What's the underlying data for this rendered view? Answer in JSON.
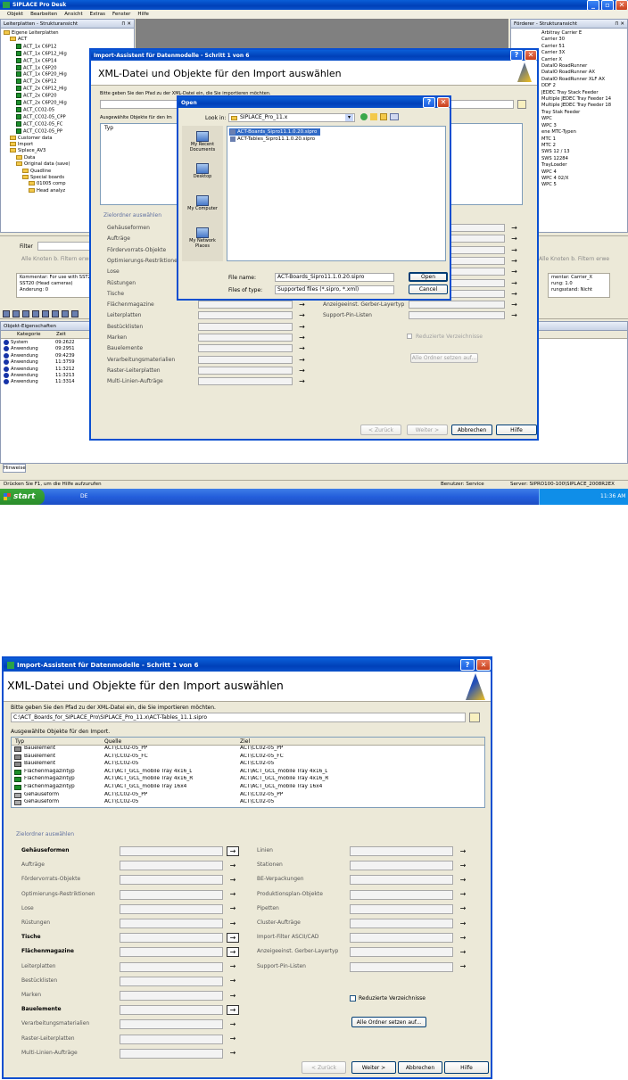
{
  "shot1": {
    "app_title": "SIPLACE Pro Desk",
    "menu": [
      "Objekt",
      "Bearbeiten",
      "Ansicht",
      "Extras",
      "Fenster",
      "Hilfe"
    ],
    "left_panel": {
      "title": "Leiterplatten - Strukturansicht",
      "tree": [
        {
          "label": "Eigene Leiterplatten",
          "depth": 0,
          "icon": "folder-icon"
        },
        {
          "label": "ACT",
          "depth": 1,
          "icon": "folder-icon"
        },
        {
          "label": "ACT_1x C6P12",
          "depth": 2,
          "icon": "board-icon"
        },
        {
          "label": "ACT_1x C6P12_Hig",
          "depth": 2,
          "icon": "board-icon"
        },
        {
          "label": "ACT_1x C6P14",
          "depth": 2,
          "icon": "board-icon"
        },
        {
          "label": "ACT_1x C6P20",
          "depth": 2,
          "icon": "board-icon"
        },
        {
          "label": "ACT_1x C6P20_Hig",
          "depth": 2,
          "icon": "board-icon"
        },
        {
          "label": "ACT_2x C6P12",
          "depth": 2,
          "icon": "board-icon"
        },
        {
          "label": "ACT_2x C6P12_Hig",
          "depth": 2,
          "icon": "board-icon"
        },
        {
          "label": "ACT_2x C6P20",
          "depth": 2,
          "icon": "board-icon"
        },
        {
          "label": "ACT_2x C6P20_Hig",
          "depth": 2,
          "icon": "board-icon"
        },
        {
          "label": "ACT_CC02-05",
          "depth": 2,
          "icon": "board-icon"
        },
        {
          "label": "ACT_CC02-05_CPP",
          "depth": 2,
          "icon": "board-icon"
        },
        {
          "label": "ACT_CC02-05_FC",
          "depth": 2,
          "icon": "board-icon"
        },
        {
          "label": "ACT_CC02-05_PP",
          "depth": 2,
          "icon": "board-icon"
        },
        {
          "label": "Customer data",
          "depth": 1,
          "icon": "folder-icon"
        },
        {
          "label": "Import",
          "depth": 1,
          "icon": "folder-icon"
        },
        {
          "label": "Siplace_AV3",
          "depth": 1,
          "icon": "folder-icon"
        },
        {
          "label": "Data",
          "depth": 2,
          "icon": "folder-icon"
        },
        {
          "label": "Original data (save)",
          "depth": 2,
          "icon": "folder-icon"
        },
        {
          "label": "Quadline",
          "depth": 3,
          "icon": "folder-icon"
        },
        {
          "label": "Special boards",
          "depth": 3,
          "icon": "folder-icon"
        },
        {
          "label": "01005 comp",
          "depth": 4,
          "icon": "folder-icon"
        },
        {
          "label": "Head analyz",
          "depth": 4,
          "icon": "folder-icon"
        }
      ],
      "filter_label": "Filter",
      "filter_reset": "Alle Knoten b. Filtern erwe",
      "comment_lines": [
        "Kommentar: For use with SST2",
        "SST20 (Head cameras)",
        "Änderung: 0"
      ]
    },
    "right_panel": {
      "title": "Förderer - Strukturansicht",
      "items": [
        "Arbitray Carrier E",
        "Carrier 30",
        "Carrier 51",
        "Carrier 3X",
        "Carrier X",
        "DataIO RoadRunner",
        "DataIO RoadRunner AX",
        "DataIO RoadRunner XLF AX",
        "DDF 2",
        "JEDEC Tray Stack Feeder",
        "Multiple JEDEC Tray Feeder 14",
        "Multiple JEDEC Tray Feeder 18",
        "Tray Stak Feeder",
        "WPC",
        "WPC 3",
        "ene MTC-Typen",
        "MTC 1",
        "MTC 2",
        "SWS 12 / 13",
        "SWS 12284",
        "TrayLoader",
        "WPC 4",
        "WPC 4 02/X",
        "WPC 5"
      ],
      "filter_reset": "Alle Knoten b. Filtern erwe",
      "comment_lines": [
        "mentar: Carrier_X",
        "rung: 1.0",
        "rungsstand: Nicht"
      ]
    },
    "props_panel": {
      "title": "Objekt-Eigenschaften",
      "col_kategorie": "Kategorie",
      "col_zeit": "Zeit",
      "rows": [
        {
          "kategorie": "System",
          "zeit": "09:2622"
        },
        {
          "kategorie": "Anwendung",
          "zeit": "09:2951"
        },
        {
          "kategorie": "Anwendung",
          "zeit": "09:4239"
        },
        {
          "kategorie": "Anwendung",
          "zeit": "11:3759"
        },
        {
          "kategorie": "Anwendung",
          "zeit": "11:3212"
        },
        {
          "kategorie": "Anwendung",
          "zeit": "11:3213"
        },
        {
          "kategorie": "Anwendung",
          "zeit": "11:3314"
        }
      ]
    },
    "hinweise_tab": "Hinweise",
    "status_hint": "Drücken Sie F1, um die Hilfe aufzurufen",
    "status_user": "Benutzer: Service",
    "status_server": "Server: SIPRO100-100\\SIPLACE_2008R2EX",
    "taskbar": {
      "start": "start",
      "lang": "DE",
      "clock": "11:36 AM"
    },
    "wizard": {
      "title": "Import-Assistent für Datenmodelle - Schritt 1 von 6",
      "heading": "XML-Datei und Objekte für den Import auswählen",
      "path_hint": "Bitte geben Sie den Pfad zu der XML-Datei ein, die Sie importieren möchten.",
      "objects_label": "Ausgewählte Objekte für den Im",
      "col_typ": "Typ",
      "zielordner": "Zielordner auswählen",
      "left_rows": [
        "Gehäuseformen",
        "Aufträge",
        "Fördervorrats-Objekte",
        "Optimierungs-Restriktionen",
        "Lose",
        "Rüstungen",
        "Tische",
        "Flächenmagazine",
        "Leiterplatten",
        "Bestücklisten",
        "Marken",
        "Bauelemente",
        "Verarbeitungsmaterialien",
        "Raster-Leiterplatten",
        "Multi-Linien-Aufträge"
      ],
      "right_rows": [
        "Anzeigeeinst. Gerber-Layertyp",
        "Support-Pin-Listen"
      ],
      "reduced_label": "Reduzierte Verzeichnisse",
      "all_folders": "Alle Ordner setzen auf...",
      "btn_back": "< Zurück",
      "btn_next": "Weiter >",
      "btn_cancel": "Abbrechen",
      "btn_help": "Hilfe"
    },
    "open_dialog": {
      "title": "Open",
      "look_in_label": "Look in:",
      "look_in_value": "SIPLACE_Pro_11.x",
      "places": [
        "My Recent Documents",
        "Desktop",
        "My Computer",
        "My Network Places"
      ],
      "files": [
        "ACT-Boards_Sipro11.1.0.20.sipro",
        "ACT-Tables_Sipro11.1.0.20.sipro"
      ],
      "file_name_label": "File name:",
      "file_name_value": "ACT-Boards_Sipro11.1.0.20.sipro",
      "file_type_label": "Files of type:",
      "file_type_value": "Supported files (*.sipro, *.xml)",
      "btn_open": "Open",
      "btn_cancel": "Cancel"
    }
  },
  "shot2": {
    "title": "Import-Assistent für Datenmodelle - Schritt 1 von 6",
    "heading": "XML-Datei und Objekte für den Import auswählen",
    "path_hint": "Bitte geben Sie den Pfad zu der XML-Datei ein, die Sie importieren möchten.",
    "path_value": "C:\\ACT_Boards_for_SIPLACE_Pro\\SIPLACE_Pro_11.x\\ACT-Tables_11.1.sipro",
    "objects_label": "Ausgewählte Objekte für den Import.",
    "columns": {
      "typ": "Typ",
      "quelle": "Quelle",
      "ziel": "Ziel"
    },
    "rows": [
      {
        "typ": "Bauelement",
        "quelle": "ACT\\CC02-05_PP",
        "ziel": "ACT\\CC02-05_PP",
        "icon": "component-icon"
      },
      {
        "typ": "Bauelement",
        "quelle": "ACT\\CC02-05_FC",
        "ziel": "ACT\\CC02-05_FC",
        "icon": "component-icon"
      },
      {
        "typ": "Bauelement",
        "quelle": "ACT\\CC02-05",
        "ziel": "ACT\\CC02-05",
        "icon": "component-icon"
      },
      {
        "typ": "Flächenmagazintyp",
        "quelle": "ACT\\ACT_GCL_mobile Tray 4x16_L",
        "ziel": "ACT\\ACT_GCL_mobile Tray 4x16_L",
        "icon": "tray-icon"
      },
      {
        "typ": "Flächenmagazintyp",
        "quelle": "ACT\\ACT_GCL_mobile Tray 4x16_R",
        "ziel": "ACT\\ACT_GCL_mobile Tray 4x16_R",
        "icon": "tray-icon"
      },
      {
        "typ": "Flächenmagazintyp",
        "quelle": "ACT\\ACT_GCL_mobile Tray 16x4",
        "ziel": "ACT\\ACT_GCL_mobile Tray 16x4",
        "icon": "tray-icon"
      },
      {
        "typ": "Gehäuseform",
        "quelle": "ACT\\CC02-05_PP",
        "ziel": "ACT\\CC02-05_PP",
        "icon": "package-icon"
      },
      {
        "typ": "Gehäuseform",
        "quelle": "ACT\\CC02-05",
        "ziel": "ACT\\CC02-05",
        "icon": "package-icon"
      }
    ],
    "zielordner": "Zielordner auswählen",
    "left_rows": [
      {
        "label": "Gehäuseformen",
        "bold": true,
        "active": true
      },
      {
        "label": "Aufträge",
        "bold": false,
        "active": false
      },
      {
        "label": "Fördervorrats-Objekte",
        "bold": false,
        "active": false
      },
      {
        "label": "Optimierungs-Restriktionen",
        "bold": false,
        "active": false
      },
      {
        "label": "Lose",
        "bold": false,
        "active": false
      },
      {
        "label": "Rüstungen",
        "bold": false,
        "active": false
      },
      {
        "label": "Tische",
        "bold": true,
        "active": true
      },
      {
        "label": "Flächenmagazine",
        "bold": true,
        "active": true
      },
      {
        "label": "Leiterplatten",
        "bold": false,
        "active": false
      },
      {
        "label": "Bestücklisten",
        "bold": false,
        "active": false
      },
      {
        "label": "Marken",
        "bold": false,
        "active": false
      },
      {
        "label": "Bauelemente",
        "bold": true,
        "active": true
      },
      {
        "label": "Verarbeitungsmaterialien",
        "bold": false,
        "active": false
      },
      {
        "label": "Raster-Leiterplatten",
        "bold": false,
        "active": false
      },
      {
        "label": "Multi-Linien-Aufträge",
        "bold": false,
        "active": false
      }
    ],
    "right_rows": [
      "Linien",
      "Stationen",
      "BE-Verpackungen",
      "Produktionsplan-Objekte",
      "Pipetten",
      "Cluster-Aufträge",
      "Import-Filter ASCII/CAD",
      "Anzeigeeinst. Gerber-Layertyp",
      "Support-Pin-Listen"
    ],
    "reduced_label": "Reduzierte Verzeichnisse",
    "all_folders": "Alle Ordner setzen auf...",
    "btn_back": "< Zurück",
    "btn_next": "Weiter >",
    "btn_cancel": "Abbrechen",
    "btn_help": "Hilfe"
  }
}
